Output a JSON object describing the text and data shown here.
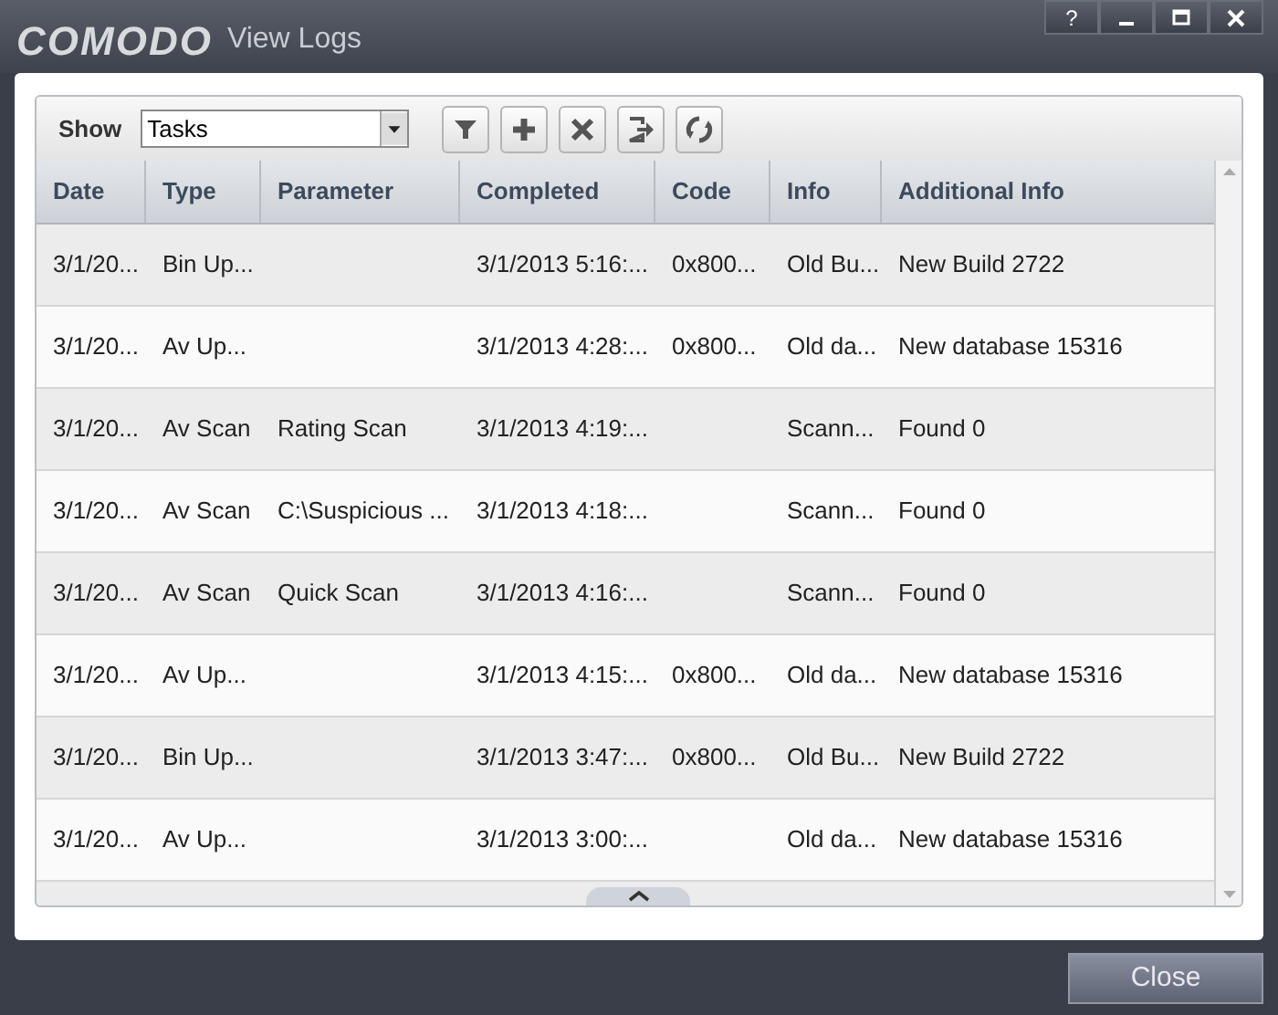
{
  "window": {
    "logo": "COMODO",
    "title": "View Logs",
    "controls": [
      {
        "kind": "help",
        "label": "?"
      },
      {
        "kind": "minimize"
      },
      {
        "kind": "maximize"
      },
      {
        "kind": "close"
      }
    ]
  },
  "toolbar": {
    "show_label": "Show",
    "dropdown_value": "Tasks",
    "buttons": [
      {
        "kind": "filter"
      },
      {
        "kind": "add"
      },
      {
        "kind": "delete"
      },
      {
        "kind": "export"
      },
      {
        "kind": "refresh"
      }
    ]
  },
  "table": {
    "columns": [
      "Date",
      "Type",
      "Parameter",
      "Completed",
      "Code",
      "Info",
      "Additional Info"
    ],
    "rows": [
      [
        "3/1/20...",
        "Bin Up...",
        "",
        "3/1/2013 5:16:...",
        "0x800...",
        "Old Bu...",
        "New Build 2722"
      ],
      [
        "3/1/20...",
        "Av Up...",
        "",
        "3/1/2013 4:28:...",
        "0x800...",
        "Old da...",
        "New database 15316"
      ],
      [
        "3/1/20...",
        "Av Scan",
        "Rating Scan",
        "3/1/2013 4:19:...",
        "",
        "Scann...",
        "Found 0"
      ],
      [
        "3/1/20...",
        "Av Scan",
        "C:\\Suspicious ...",
        "3/1/2013 4:18:...",
        "",
        "Scann...",
        "Found 0"
      ],
      [
        "3/1/20...",
        "Av Scan",
        "Quick Scan",
        "3/1/2013 4:16:...",
        "",
        "Scann...",
        "Found 0"
      ],
      [
        "3/1/20...",
        "Av Up...",
        "",
        "3/1/2013 4:15:...",
        "0x800...",
        "Old da...",
        "New database 15316"
      ],
      [
        "3/1/20...",
        "Bin Up...",
        "",
        "3/1/2013 3:47:...",
        "0x800...",
        "Old Bu...",
        "New Build 2722"
      ],
      [
        "3/1/20...",
        "Av Up...",
        "",
        "3/1/2013 3:00:...",
        "",
        "Old da...",
        "New database 15316"
      ]
    ]
  },
  "footer": {
    "close_button": "Close"
  }
}
